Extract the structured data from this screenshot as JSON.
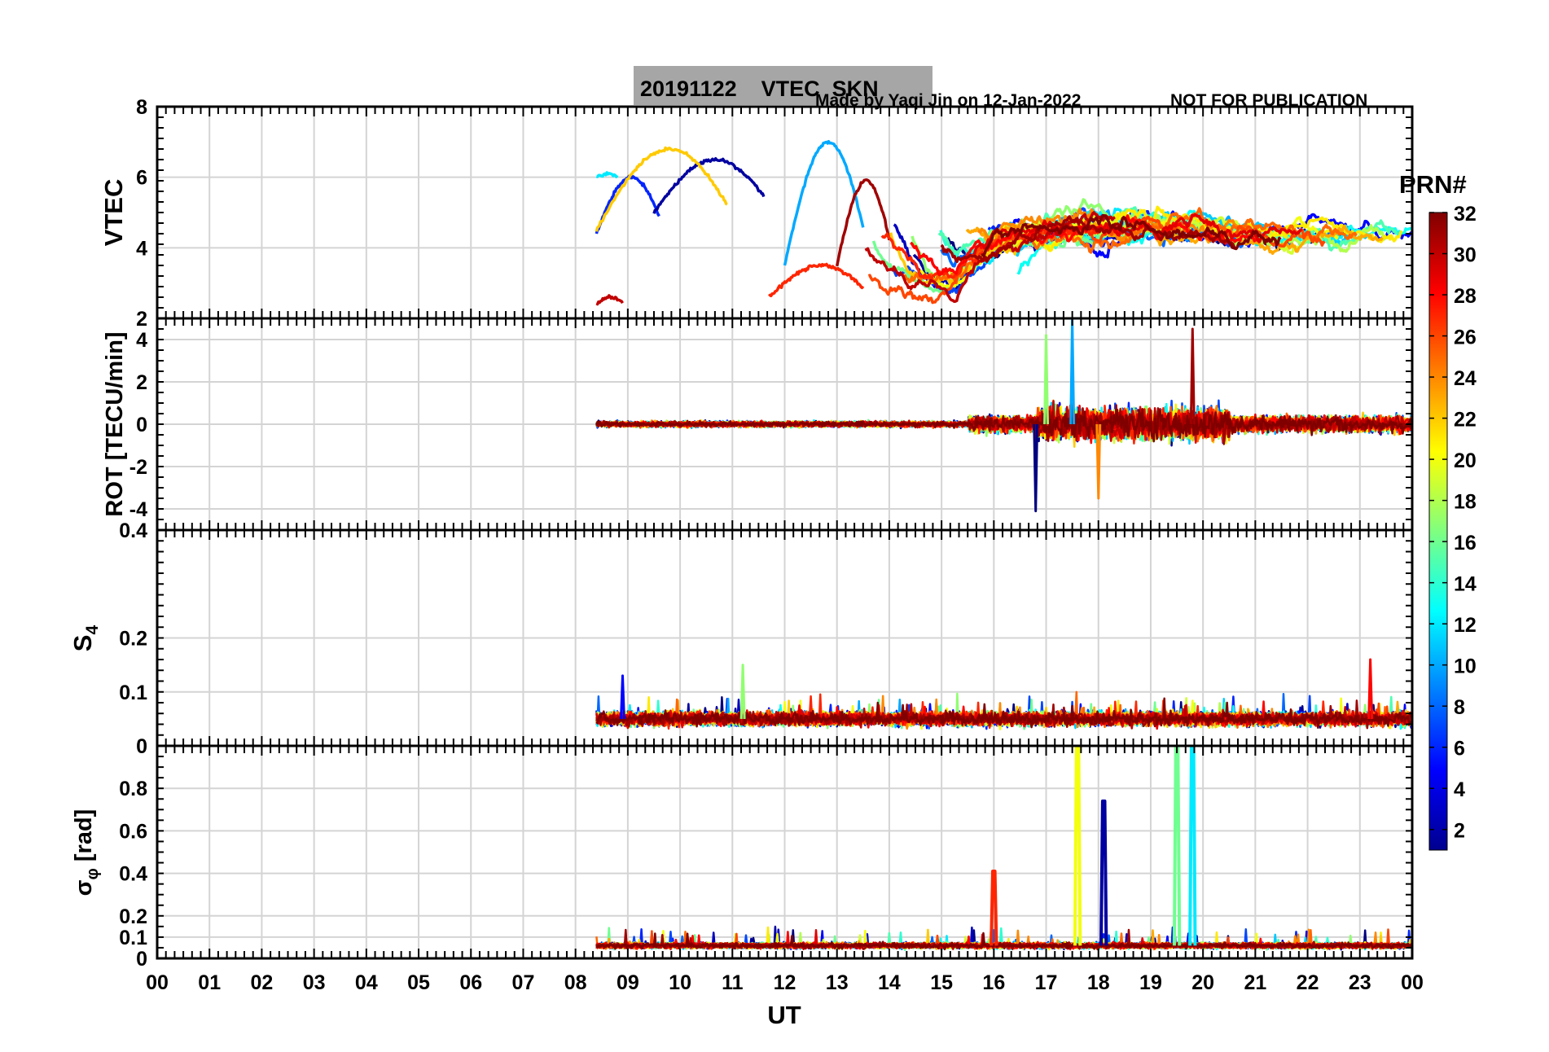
{
  "header": {
    "title": "20191122    VTEC  SKN",
    "credit": "Made by Yaqi Jin on 12-Jan-2022",
    "notice": "NOT FOR PUBLICATION",
    "title_bg": "#a6a6a6",
    "credit_color": "#0000ff"
  },
  "colorbar": {
    "title": "PRN#",
    "ticks": [
      "2",
      "4",
      "6",
      "8",
      "10",
      "12",
      "14",
      "16",
      "18",
      "20",
      "22",
      "24",
      "26",
      "28",
      "30",
      "32"
    ],
    "tick_values": [
      2,
      4,
      6,
      8,
      10,
      12,
      14,
      16,
      18,
      20,
      22,
      24,
      26,
      28,
      30,
      32
    ],
    "range": [
      1,
      32
    ],
    "colormap": "jet"
  },
  "chart_data": [
    {
      "type": "line",
      "panel": "vtec",
      "ylabel": "VTEC",
      "ylim": [
        2,
        8
      ],
      "yticks": [
        "2",
        "4",
        "6",
        "8"
      ],
      "ytick_values": [
        2,
        4,
        6,
        8
      ],
      "grid": true,
      "series_summary": [
        {
          "prn": 6,
          "x_range_hours": [
            8.4,
            9.6
          ],
          "y_approx": [
            4.4,
            6.0
          ]
        },
        {
          "prn": 2,
          "x_range_hours": [
            9.5,
            11.6
          ],
          "y_approx": [
            5.0,
            6.5
          ]
        },
        {
          "prn": 12,
          "x_range_hours": [
            8.4,
            8.8
          ],
          "y_approx": [
            6.0,
            6.1
          ]
        },
        {
          "prn": 22,
          "x_range_hours": [
            8.4,
            10.9
          ],
          "y_approx": [
            4.5,
            6.8
          ]
        },
        {
          "prn": 10,
          "x_range_hours": [
            12.0,
            13.5
          ],
          "y_approx": [
            3.5,
            7.0
          ]
        },
        {
          "prn": 31,
          "x_range_hours": [
            13.0,
            14.0
          ],
          "y_approx": [
            3.5,
            5.9
          ]
        },
        {
          "prn": 30,
          "x_range_hours": [
            8.4,
            8.9
          ],
          "y_approx": [
            2.4,
            2.6
          ]
        },
        {
          "prn": 27,
          "x_range_hours": [
            11.7,
            13.5
          ],
          "y_approx": [
            2.6,
            3.5
          ]
        }
      ]
    },
    {
      "type": "line",
      "panel": "rot",
      "ylabel": "ROT [TECU/min]",
      "ylim": [
        -5,
        5
      ],
      "yticks": [
        "-4",
        "-2",
        "0",
        "2",
        "4"
      ],
      "ytick_values": [
        -4,
        -2,
        0,
        2,
        4
      ],
      "grid": true,
      "notable_spikes": [
        {
          "x_hour": 16.8,
          "y": -4.1
        },
        {
          "x_hour": 17.5,
          "y": 5.0
        },
        {
          "x_hour": 17.0,
          "y": 4.2
        },
        {
          "x_hour": 18.0,
          "y": -3.5
        },
        {
          "x_hour": 19.8,
          "y": 4.5
        }
      ]
    },
    {
      "type": "line",
      "panel": "s4",
      "ylabel": "S4",
      "ylim": [
        0,
        0.4
      ],
      "yticks": [
        "0",
        "0.1",
        "0.2",
        "0.4"
      ],
      "ytick_values": [
        0,
        0.1,
        0.2,
        0.4
      ],
      "grid": true,
      "baseline_level": 0.05,
      "notable_spikes": [
        {
          "x_hour": 8.9,
          "y": 0.13
        },
        {
          "x_hour": 11.2,
          "y": 0.15
        },
        {
          "x_hour": 23.2,
          "y": 0.16
        }
      ]
    },
    {
      "type": "line",
      "panel": "sigma_phi",
      "ylabel": "σφ [rad]",
      "xlabel": "UT",
      "ylim": [
        0,
        1.0
      ],
      "yticks": [
        "0",
        "0.1",
        "0.2",
        "0.4",
        "0.6",
        "0.8"
      ],
      "ytick_values": [
        0,
        0.1,
        0.2,
        0.4,
        0.6,
        0.8
      ],
      "xlim": [
        0,
        24
      ],
      "xticks": [
        "00",
        "01",
        "02",
        "03",
        "04",
        "05",
        "06",
        "07",
        "08",
        "09",
        "10",
        "11",
        "12",
        "13",
        "14",
        "15",
        "16",
        "17",
        "18",
        "19",
        "20",
        "21",
        "22",
        "23",
        "00"
      ],
      "grid": true,
      "baseline_level": 0.06,
      "notable_spikes": [
        {
          "x_hour": 16.0,
          "y": 0.41
        },
        {
          "x_hour": 17.6,
          "y": 1.0
        },
        {
          "x_hour": 18.1,
          "y": 0.74
        },
        {
          "x_hour": 19.5,
          "y": 1.0
        },
        {
          "x_hour": 19.8,
          "y": 1.0
        }
      ]
    }
  ]
}
